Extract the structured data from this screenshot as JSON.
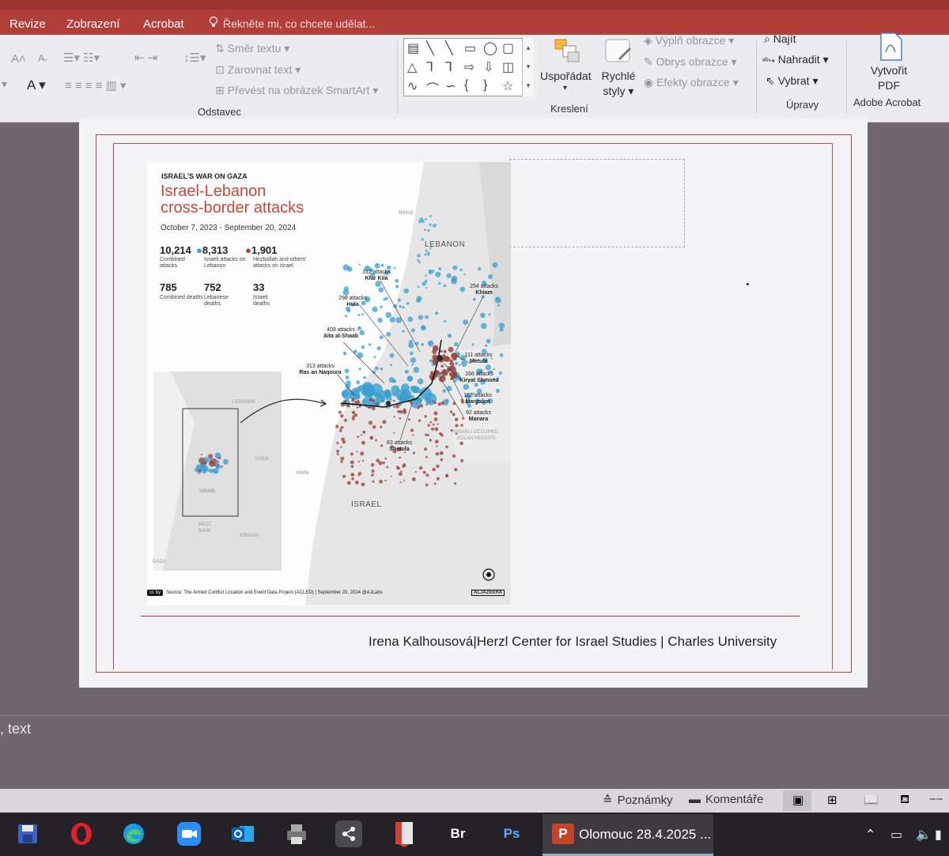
{
  "ribbon": {
    "tabs": [
      "Revize",
      "Zobrazení",
      "Acrobat"
    ],
    "tell_me": "Řekněte mi, co chcete udělat...",
    "paragraph": {
      "text_direction": "Směr textu",
      "align_text": "Zarovnat text",
      "smartart": "Převést na obrázek SmartArt",
      "group_label": "Odstavec"
    },
    "drawing": {
      "arrange": "Uspořádat",
      "quick_styles": "Rychlé styly",
      "fill": "Výplň obrazce",
      "outline": "Obrys obrazce",
      "effects": "Efekty obrazce",
      "group_label": "Kreslení"
    },
    "editing": {
      "find": "Najít",
      "replace": "Nahradit",
      "select": "Vybrat",
      "group_label": "Úpravy"
    },
    "acrobat": {
      "create_pdf": "Vytvořit PDF",
      "group_label": "Adobe Acrobat"
    }
  },
  "slide": {
    "map": {
      "kicker": "ISRAEL'S WAR ON GAZA",
      "title_line1": "Israel-Lebanon",
      "title_line2": "cross-border attacks",
      "date_range": "October 7, 2023 - September 20, 2024",
      "stats": [
        {
          "value": "10,214",
          "label": "Combined attacks"
        },
        {
          "value": "8,313",
          "label": "Israeli attacks on Lebanon"
        },
        {
          "value": "1,901",
          "label": "Hezbollah and others' attacks on Israel"
        },
        {
          "value": "785",
          "label": "Combined deaths"
        },
        {
          "value": "752",
          "label": "Lebanese deaths"
        },
        {
          "value": "33",
          "label": "Israeli deaths"
        }
      ],
      "places": [
        {
          "count": "312 attacks",
          "name": "Kfar Kila"
        },
        {
          "count": "254 attacks",
          "name": "Khiam"
        },
        {
          "count": "298 attacks",
          "name": "Hula"
        },
        {
          "count": "409 attacks",
          "name": "Aita al-Shaab"
        },
        {
          "count": "313 attacks",
          "name": "Ras an Naqoura"
        },
        {
          "count": "111 attacks",
          "name": "Metula"
        },
        {
          "count": "166 attacks",
          "name": "Kiryat Shmona"
        },
        {
          "count": "103 attacks",
          "name": "Margaliot"
        },
        {
          "count": "92 attacks",
          "name": "Manara"
        },
        {
          "count": "83 attacks",
          "name": "Shetula"
        }
      ],
      "countries": {
        "lebanon": "LEBANON",
        "israel": "ISRAEL",
        "golan": "ISRAELI-OCCUPIED GOLAN HEIGHTS",
        "beirut": "Beirut",
        "haifa": "Haifa"
      },
      "inset": {
        "lebanon": "LEBANON",
        "syria": "SYRIA",
        "israel": "ISRAEL",
        "west_bank": "WEST BANK",
        "jordan": "JORDAN",
        "gaza": "GAZA"
      },
      "source": "Source: The Armed Conflict Location and Event Data Project (ACLED) | September 20, 2024 @AJLabs",
      "logo": "ALJAZEERA",
      "colors": {
        "israeli_attacks": "#3a9fd0",
        "hezbollah_attacks": "#a0473a",
        "title": "#c04a3c"
      }
    },
    "footer": "Irena Kalhousová|Herzl Center for Israel Studies | Charles University"
  },
  "notes_placeholder": ", text",
  "statusbar": {
    "notes": "Poznámky",
    "comments": "Komentáře"
  },
  "taskbar": {
    "active_window": "Olomouc 28.4.2025 ...",
    "bridge_label": "Br",
    "photoshop_label": "Ps"
  }
}
